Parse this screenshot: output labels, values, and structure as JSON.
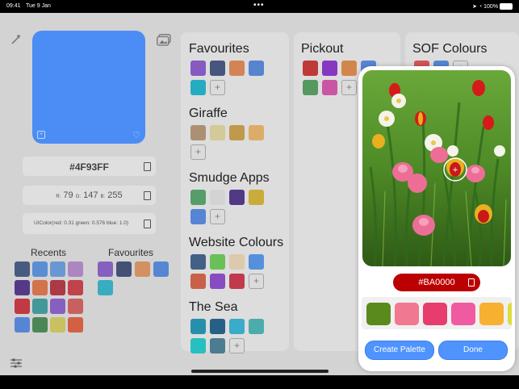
{
  "status_bar": {
    "time": "09:41",
    "date": "Tue 9 Jan",
    "battery": "100%"
  },
  "left": {
    "hex_value": "#4F93FF",
    "rgb": {
      "r_label": "R:",
      "r": "79",
      "g_label": "G:",
      "g": "147",
      "b_label": "B:",
      "b": "255"
    },
    "uicolor_text": "UIColor(red: 0.31 green: 0.576 blue: 1.0)",
    "recents_title": "Recents",
    "favourites_title": "Favourites",
    "recents": [
      "#4a5f86",
      "#5e94dc",
      "#6e9edc",
      "#b48cc8",
      "#5a3c8c",
      "#dc7850",
      "#b43c46",
      "#c84650",
      "#c83c46",
      "#46a0a0",
      "#8c64c8",
      "#d26464",
      "#5a8cdc",
      "#508c5a",
      "#d2c864",
      "#dc6446"
    ],
    "favourites": [
      "#8c64c8",
      "#46557a",
      "#dc9664",
      "#5a8cdc",
      "#3cb4c8"
    ]
  },
  "palettes": [
    {
      "title": "Favourites",
      "colors": [
        "#8c5fc8",
        "#4a5a82",
        "#dc8a5a",
        "#5a8ad8",
        "#28b4c8"
      ]
    },
    {
      "title": "Giraffe",
      "colors": [
        "#b49678",
        "#dcd2a0",
        "#c8a050",
        "#e6b46e"
      ]
    },
    {
      "title": "Smudge Apps",
      "colors": [
        "#5aa56e",
        "#dcdcdc",
        "#553c8c",
        "#d2b43c",
        "#5a8cdc"
      ]
    },
    {
      "title": "Website Colours",
      "colors": [
        "#46648c",
        "#6ec85a",
        "#e6d2b4",
        "#5a96e6",
        "#d2644b",
        "#8c50c8",
        "#c83c50"
      ]
    },
    {
      "title": "The Sea",
      "colors": [
        "#2896b4",
        "#28648c",
        "#3cb4d2",
        "#50b4b4",
        "#28c8c8",
        "#508296"
      ]
    },
    {
      "title": "Pickout",
      "colors": [
        "#c83c3c",
        "#8c3cc8",
        "#dc8c50",
        "#5a8cdc",
        "#5aa064",
        "#d25aaa"
      ]
    },
    {
      "title": "SOF Colours",
      "colors": [
        "#dc5a5a",
        "#5a8cdc"
      ]
    }
  ],
  "picker": {
    "hex_value": "#BA0000",
    "hex_color": "#BA0000",
    "swatches": [
      "#5a8a1e",
      "#f07890",
      "#e63c6e",
      "#f05aa0",
      "#f8b030",
      "#dcdc3c"
    ],
    "create_palette_label": "Create Palette",
    "done_label": "Done"
  }
}
